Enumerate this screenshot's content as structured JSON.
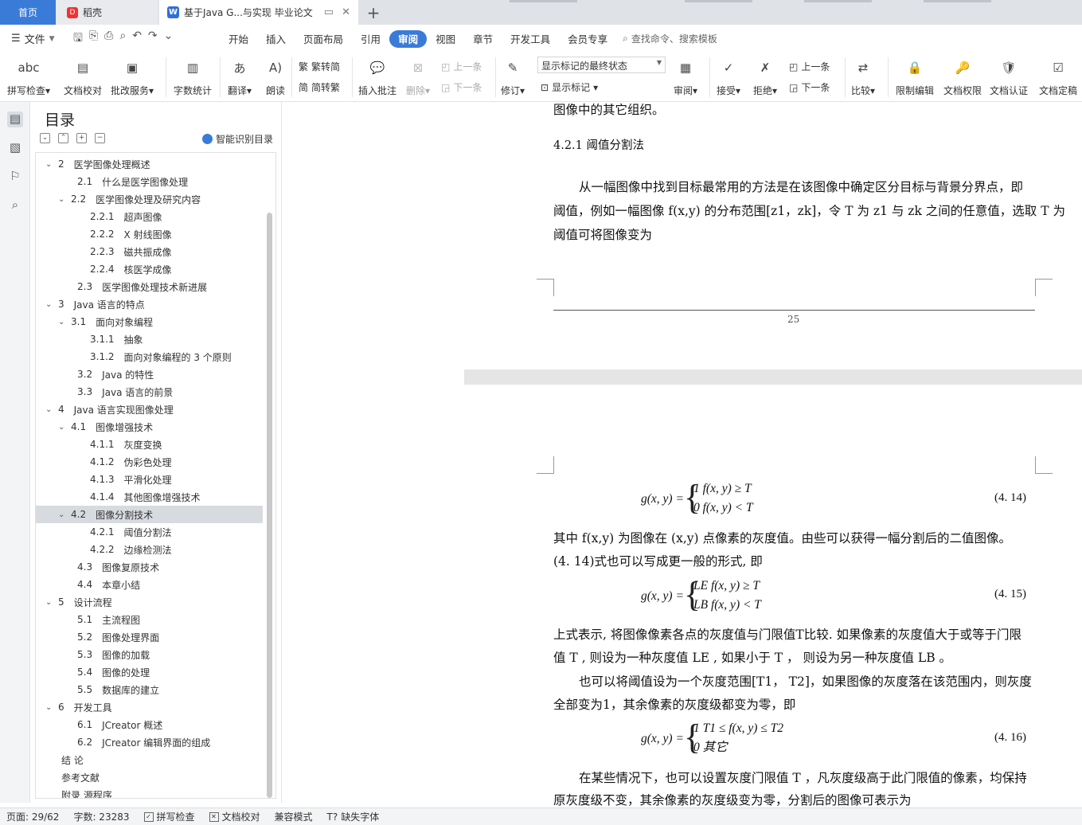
{
  "tabs": {
    "home": "首页",
    "daoke": "稻壳",
    "doc": "基于Java G...与实现 毕业论文",
    "add": "+"
  },
  "menubar": {
    "file": "文件",
    "items": [
      "开始",
      "插入",
      "页面布局",
      "引用",
      "审阅",
      "视图",
      "章节",
      "开发工具",
      "会员专享"
    ],
    "active": "审阅",
    "search": "查找命令、搜索模板"
  },
  "ribbon": {
    "spell": "拼写检查",
    "proof": "文档校对",
    "batch": "批改服务",
    "wordcount": "字数统计",
    "translate": "翻译",
    "read": "朗读",
    "trad": "繁转简",
    "simp": "简转繁",
    "insert_comment": "插入批注",
    "delete": "删除",
    "prev": "上一条",
    "next": "下一条",
    "revise": "修订",
    "display_state": "显示标记的最终状态",
    "show_marks": "显示标记",
    "review": "审阅",
    "accept": "接受",
    "reject": "拒绝",
    "prev2": "上一条",
    "next2": "下一条",
    "compare": "比较",
    "restrict": "限制编辑",
    "permission": "文档权限",
    "certify": "文档认证",
    "finalize": "文档定稿"
  },
  "toc": {
    "title": "目录",
    "smart": "智能识别目录",
    "selected_index": 20,
    "items": [
      {
        "num": "2",
        "text": "医学图像处理概述",
        "level": 1,
        "chev": true
      },
      {
        "num": "2.1",
        "text": "什么是医学图像处理",
        "level": 2,
        "chev": false
      },
      {
        "num": "2.2",
        "text": "医学图像处理及研究内容",
        "level": 2,
        "chev": true
      },
      {
        "num": "2.2.1",
        "text": "超声图像",
        "level": 3,
        "chev": false
      },
      {
        "num": "2.2.2",
        "text": "X 射线图像",
        "level": 3,
        "chev": false
      },
      {
        "num": "2.2.3",
        "text": "磁共振成像",
        "level": 3,
        "chev": false
      },
      {
        "num": "2.2.4",
        "text": "核医学成像",
        "level": 3,
        "chev": false
      },
      {
        "num": "2.3",
        "text": "医学图像处理技术新进展",
        "level": 2,
        "chev": false
      },
      {
        "num": "3",
        "text": "Java 语言的特点",
        "level": 1,
        "chev": true
      },
      {
        "num": "3.1",
        "text": "面向对象编程",
        "level": 2,
        "chev": true
      },
      {
        "num": "3.1.1",
        "text": "抽象",
        "level": 3,
        "chev": false
      },
      {
        "num": "3.1.2",
        "text": "面向对象编程的 3 个原则",
        "level": 3,
        "chev": false
      },
      {
        "num": "3.2",
        "text": "Java 的特性",
        "level": 2,
        "chev": false
      },
      {
        "num": "3.3",
        "text": "Java 语言的前景",
        "level": 2,
        "chev": false
      },
      {
        "num": "4",
        "text": "Java 语言实现图像处理",
        "level": 1,
        "chev": true
      },
      {
        "num": "4.1",
        "text": "图像增强技术",
        "level": 2,
        "chev": true
      },
      {
        "num": "4.1.1",
        "text": "灰度变换",
        "level": 3,
        "chev": false
      },
      {
        "num": "4.1.2",
        "text": "伪彩色处理",
        "level": 3,
        "chev": false
      },
      {
        "num": "4.1.3",
        "text": "平滑化处理",
        "level": 3,
        "chev": false
      },
      {
        "num": "4.1.4",
        "text": "其他图像增强技术",
        "level": 3,
        "chev": false
      },
      {
        "num": "4.2",
        "text": "图像分割技术",
        "level": 2,
        "chev": true
      },
      {
        "num": "4.2.1",
        "text": "阈值分割法",
        "level": 3,
        "chev": false
      },
      {
        "num": "4.2.2",
        "text": "边缘检测法",
        "level": 3,
        "chev": false
      },
      {
        "num": "4.3",
        "text": "图像复原技术",
        "level": 2,
        "chev": false
      },
      {
        "num": "4.4",
        "text": "本章小结",
        "level": 2,
        "chev": false
      },
      {
        "num": "5",
        "text": "设计流程",
        "level": 1,
        "chev": true
      },
      {
        "num": "5.1",
        "text": "主流程图",
        "level": 2,
        "chev": false
      },
      {
        "num": "5.2",
        "text": "图像处理界面",
        "level": 2,
        "chev": false
      },
      {
        "num": "5.3",
        "text": "图像的加载",
        "level": 2,
        "chev": false
      },
      {
        "num": "5.4",
        "text": "图像的处理",
        "level": 2,
        "chev": false
      },
      {
        "num": "5.5",
        "text": "数据库的建立",
        "level": 2,
        "chev": false
      },
      {
        "num": "6",
        "text": "开发工具",
        "level": 1,
        "chev": true
      },
      {
        "num": "6.1",
        "text": "JCreator 概述",
        "level": 2,
        "chev": false
      },
      {
        "num": "6.2",
        "text": "JCreator 编辑界面的组成",
        "level": 2,
        "chev": false
      },
      {
        "num": "",
        "text": "结  论",
        "level": 0,
        "chev": false
      },
      {
        "num": "",
        "text": "参考文献",
        "level": 0,
        "chev": false
      },
      {
        "num": "",
        "text": "附录   源程序",
        "level": 0,
        "chev": false
      }
    ]
  },
  "doc": {
    "top_line": "图像中的其它组织。",
    "heading": "4.2.1    阈值分割法",
    "p1_l1": "从一幅图像中找到目标最常用的方法是在该图像中确定区分目标与背景分界点，即",
    "p1_l2": "阈值，例如一幅图像 f(x,y) 的分布范围[z1，zk]，令 T 为 z1 与 zk 之间的任意值，选取 T 为",
    "p1_l3": "阈值可将图像变为",
    "page_number": "25",
    "eq14_lhs": "g(x, y) =",
    "eq14_r1": "1        f(x, y) ≥ T",
    "eq14_r2": "0        f(x, y) < T",
    "eq14_no": "(4. 14)",
    "p2_l1": "其中 f(x,y) 为图像在 (x,y) 点像素的灰度值。由些可以获得一幅分割后的二值图像。",
    "p2_l2": "(4. 14)式也可以写成更一般的形式, 即",
    "eq15_lhs": "g(x, y) =",
    "eq15_r1": "LE      f(x, y) ≥ T",
    "eq15_r2": "LB      f(x, y) < T",
    "eq15_no": "(4. 15)",
    "p3_l1": "上式表示, 将图像像素各点的灰度值与门限值T比较. 如果像素的灰度值大于或等于门限",
    "p3_l2": "值 T , 则设为一种灰度值 LE , 如果小于 T ， 则设为另一种灰度值 LB 。",
    "p4_l1": "也可以将阈值设为一个灰度范围[T1， T2]，如果图像的灰度落在该范围内，则灰度",
    "p4_l2": "全部变为1，其余像素的灰度级都变为零，即",
    "eq16_lhs": "g(x, y) =",
    "eq16_r1": "1        T1 ≤ f(x, y) ≤ T2",
    "eq16_r2": "0              其它",
    "eq16_no": "(4. 16)",
    "p5_l1": "在某些情况下，也可以设置灰度门限值 T ，凡灰度级高于此门限值的像素，均保持",
    "p5_l2": "原灰度级不变，其余像素的灰度级变为零，分割后的图像可表示为"
  },
  "status": {
    "page": "页面: 29/62",
    "words": "字数: 23283",
    "spell": "拼写检查",
    "proof": "文档校对",
    "compat": "兼容模式",
    "font": "缺失字体"
  }
}
